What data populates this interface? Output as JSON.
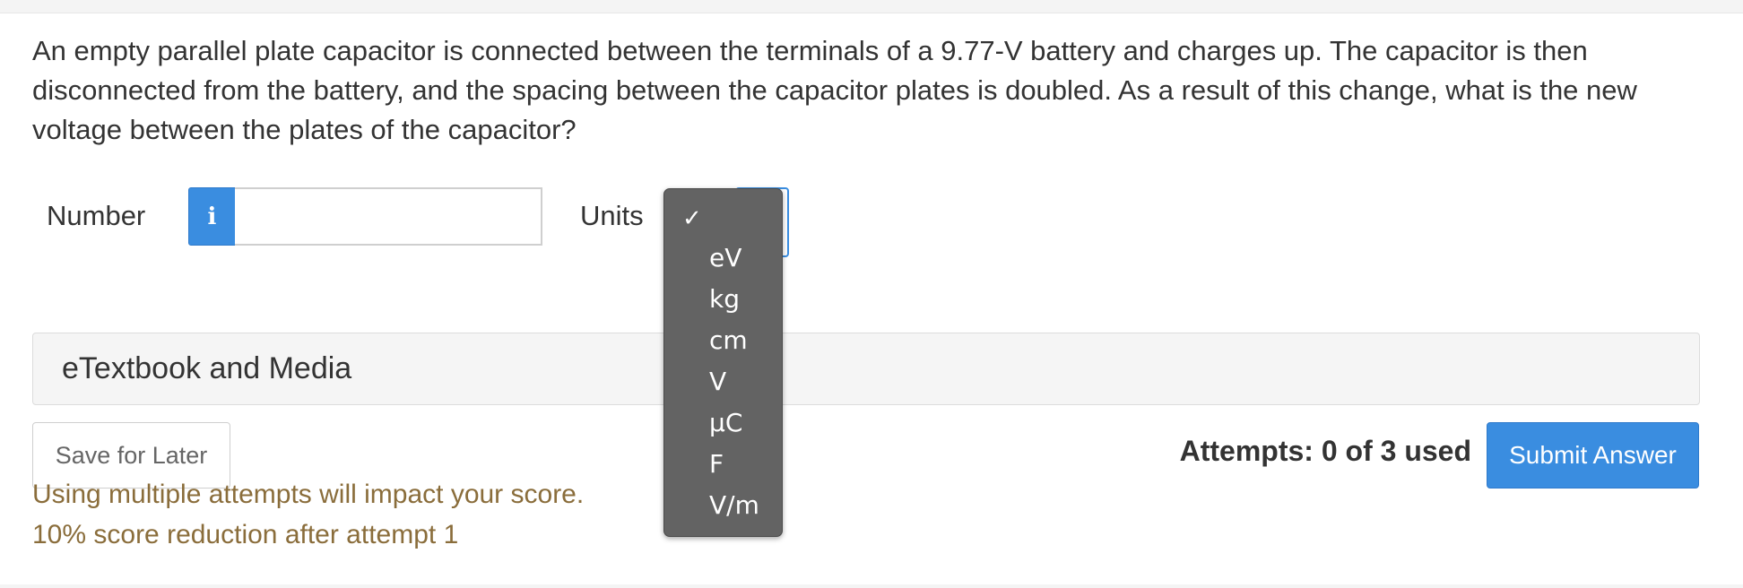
{
  "question": {
    "text": "An empty parallel plate capacitor is connected between the terminals of a 9.77-V battery and charges up. The capacitor is then disconnected from the battery, and the spacing between the capacitor plates is doubled. As a result of this change, what is the new voltage between the plates of the capacitor?"
  },
  "answer_row": {
    "number_label": "Number",
    "info_icon_glyph": "i",
    "number_value": "",
    "units_label": "Units",
    "units_selected": ""
  },
  "units_dropdown": {
    "checkmark": "✓",
    "options": [
      "eV",
      "kg",
      "cm",
      "V",
      "µC",
      "F",
      "V/m"
    ]
  },
  "media": {
    "title": "eTextbook and Media"
  },
  "actions": {
    "save_label": "Save for Later",
    "attempts_text": "Attempts: 0 of 3 used",
    "submit_label": "Submit Answer"
  },
  "notices": {
    "line1": "Using multiple attempts will impact your score.",
    "line2": "10% score reduction after attempt 1"
  },
  "colors": {
    "accent": "#3a8de0",
    "warning_text": "#8a6d3b",
    "dropdown_bg": "#636363"
  }
}
